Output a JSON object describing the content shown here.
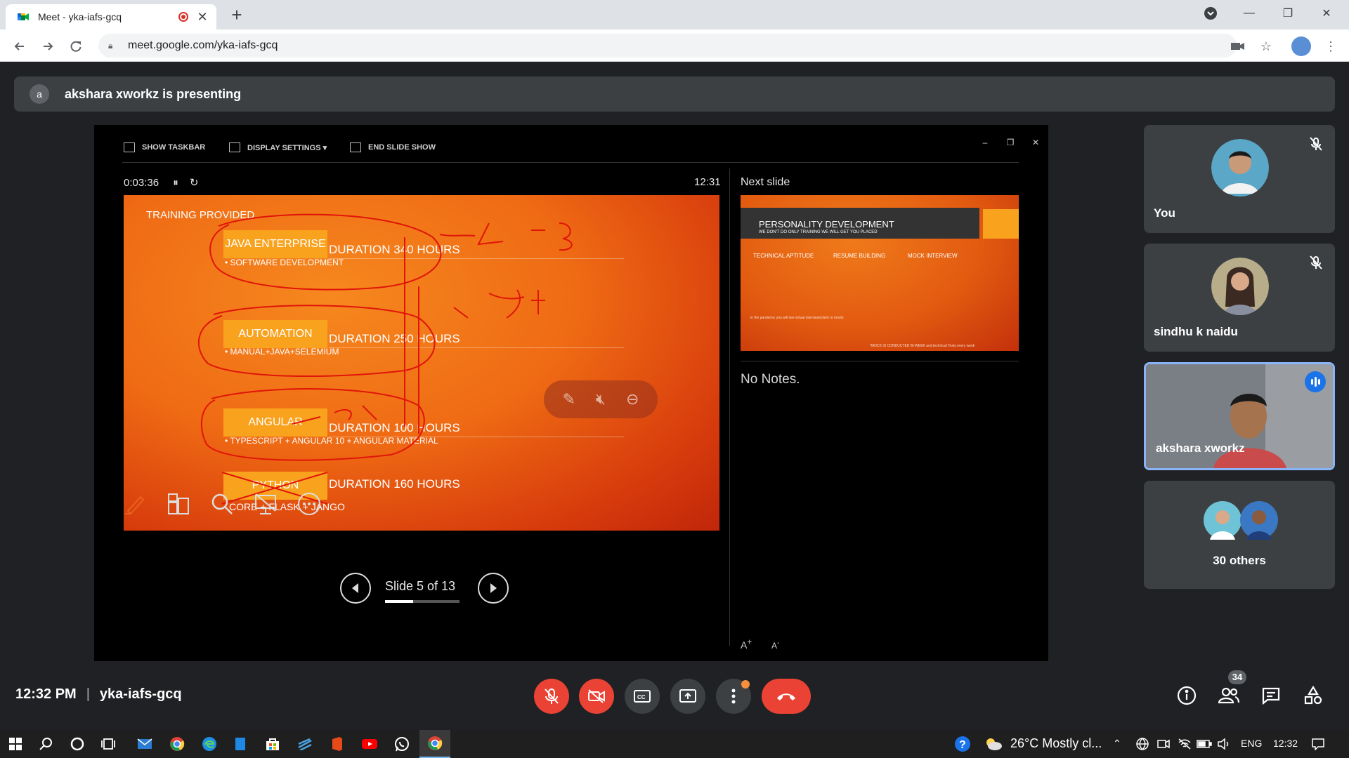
{
  "browser": {
    "tab_title": "Meet - yka-iafs-gcq",
    "url": "meet.google.com/yka-iafs-gcq"
  },
  "meet": {
    "presenting_initial": "a",
    "presenting_text": "akshara xworkz is presenting",
    "meeting_time": "12:32 PM",
    "meeting_code": "yka-iafs-gcq",
    "participant_count": "34"
  },
  "presenter_view": {
    "toolbar": {
      "show_taskbar": "SHOW TASKBAR",
      "display_settings": "DISPLAY SETTINGS ▾",
      "end_slide_show": "END SLIDE SHOW"
    },
    "elapsed": "0:03:36",
    "clock": "12:31",
    "next_slide_label": "Next slide",
    "notes": "No Notes.",
    "slide_counter": "Slide 5 of 13",
    "slide_progress": 0.38
  },
  "current_slide": {
    "title": "TRAINING PROVIDED",
    "courses": [
      {
        "name": "JAVA ENTERPRISE",
        "duration": "DURATION 340 HOURS",
        "detail": "• SOFTWARE DEVELOPMENT"
      },
      {
        "name": "AUTOMATION",
        "duration": "DURATION 250 HOURS",
        "detail": "• MANUAL+JAVA+SELEMIUM"
      },
      {
        "name": "ANGULAR",
        "duration": "DURATION 100 HOURS",
        "detail": "• TYPESCRIPT + ANGULAR 10 + ANGULAR MATERIAL"
      },
      {
        "name": "PYTHON",
        "duration": "DURATION 160 HOURS",
        "detail": "CORE + FLASK + JANGO"
      }
    ]
  },
  "next_slide": {
    "title": "PERSONALITY DEVELOPMENT",
    "subtitle": "WE DON'T DO ONLY TRAINING WE WILL GET YOU PLACED",
    "col1": "TECHNICAL APTITUDE",
    "col2": "RESUME BUILDING",
    "col3": "MOCK INTERVIEW",
    "pandemic": "in the pandemic you will see virtual interview(client or mock)",
    "footer": "*MOCK IS CONDUCTED BI-WEEK and technical Tests every week"
  },
  "participants": [
    {
      "name": "You",
      "muted": true
    },
    {
      "name": "sindhu k naidu",
      "muted": true
    },
    {
      "name": "akshara xworkz",
      "speaking": true
    },
    {
      "name": "30 others"
    }
  ],
  "taskbar": {
    "weather": "26°C  Mostly cl...",
    "language": "ENG",
    "time": "12:32"
  },
  "colors": {
    "meet_bg": "#202124",
    "slide_orange": "#ef6a14",
    "course_box": "#f9a21d",
    "end_call_red": "#ea4335",
    "active_tile_border": "#8ab4f8"
  }
}
